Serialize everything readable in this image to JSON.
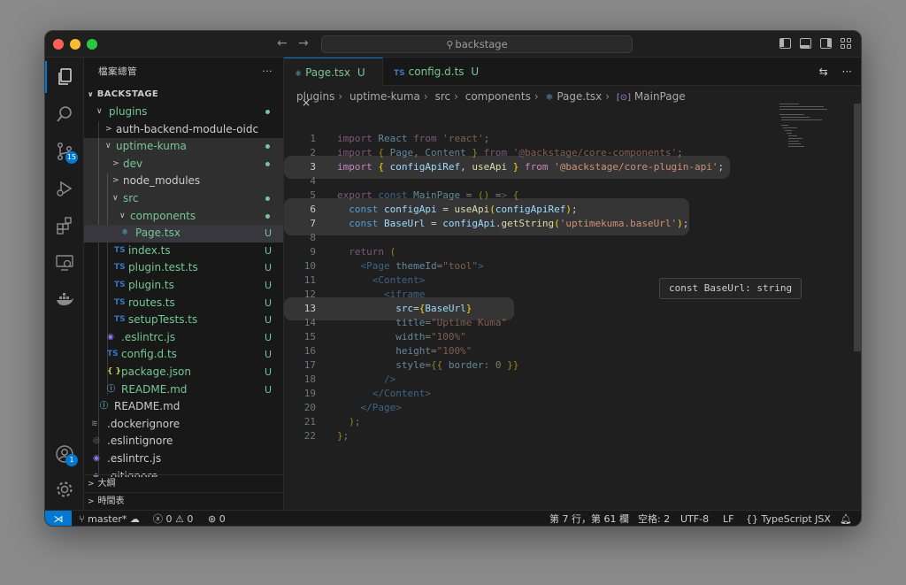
{
  "titlebar": {
    "search_text": "backstage",
    "back_icon": "arrow-left-icon",
    "forward_icon": "arrow-right-icon"
  },
  "activity_bar": {
    "source_control_badge": "15",
    "accounts_badge": "1"
  },
  "sidebar": {
    "title": "檔案總管",
    "more": "···",
    "root": "BACKSTAGE",
    "items": [
      {
        "label": "plugins"
      },
      {
        "label": "auth-backend-module-oidc"
      },
      {
        "label": "uptime-kuma"
      },
      {
        "label": "dev"
      },
      {
        "label": "node_modules"
      },
      {
        "label": "src"
      },
      {
        "label": "components"
      },
      {
        "label": "Page.tsx",
        "status": "U"
      },
      {
        "label": "index.ts",
        "status": "U"
      },
      {
        "label": "plugin.test.ts",
        "status": "U"
      },
      {
        "label": "plugin.ts",
        "status": "U"
      },
      {
        "label": "routes.ts",
        "status": "U"
      },
      {
        "label": "setupTests.ts",
        "status": "U"
      },
      {
        "label": ".eslintrc.js",
        "status": "U"
      },
      {
        "label": "config.d.ts",
        "status": "U"
      },
      {
        "label": "package.json",
        "status": "U"
      },
      {
        "label": "README.md",
        "status": "U"
      },
      {
        "label": "README.md"
      },
      {
        "label": ".dockerignore"
      },
      {
        "label": ".eslintignore"
      },
      {
        "label": ".eslintrc.js"
      },
      {
        "label": ".gitignore"
      }
    ],
    "outline": "大綱",
    "timeline": "時間表"
  },
  "tabs": [
    {
      "label": "Page.tsx",
      "status": "U",
      "close": "×"
    },
    {
      "label": "config.d.ts",
      "status": "U"
    }
  ],
  "tab_icons": {
    "tsx": "⚛",
    "ts": "TS"
  },
  "breadcrumb": [
    "plugins",
    "uptime-kuma",
    "src",
    "components",
    "Page.tsx",
    "MainPage"
  ],
  "code_lines": [
    "import React from 'react';",
    "import { Page, Content } from '@backstage/core-components';",
    "import { configApiRef, useApi } from '@backstage/core-plugin-api';",
    "",
    "export const MainPage = () => {",
    "  const configApi = useApi(configApiRef);",
    "  const BaseUrl = configApi.getString('uptimekuma.baseUrl');",
    "",
    "  return (",
    "    <Page themeId=\"tool\">",
    "      <Content>",
    "        <iframe",
    "          src={BaseUrl}",
    "          title=\"Uptime Kuma\"",
    "          width=\"100%\"",
    "          height=\"100%\"",
    "          style={{ border: 0 }}",
    "        />",
    "      </Content>",
    "    </Page>",
    "  );",
    "};"
  ],
  "hover_tooltip": "const BaseUrl: string",
  "statusbar": {
    "branch": "master*",
    "errors": "0",
    "warnings": "0",
    "ports": "0",
    "position": "第 7 行，第 61 欄",
    "spaces": "空格: 2",
    "encoding": "UTF-8",
    "eol": "LF",
    "language": "TypeScript JSX"
  }
}
